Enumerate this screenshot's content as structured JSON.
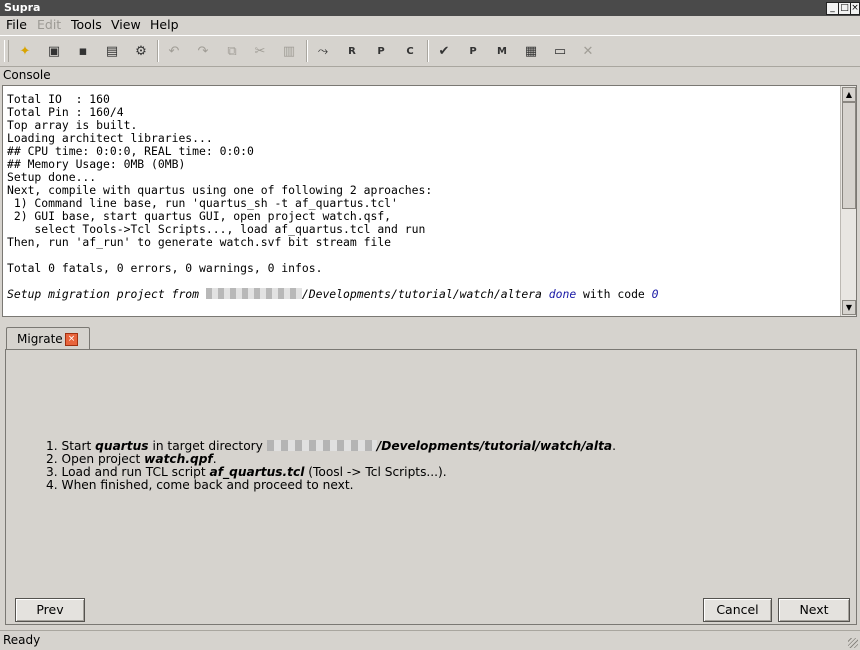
{
  "window": {
    "title": "Supra"
  },
  "menubar": {
    "items": [
      {
        "label": "File",
        "enabled": true
      },
      {
        "label": "Edit",
        "enabled": false
      },
      {
        "label": "Tools",
        "enabled": true
      },
      {
        "label": "View",
        "enabled": true
      },
      {
        "label": "Help",
        "enabled": true
      }
    ]
  },
  "toolbar": {
    "buttons": [
      {
        "icon": "new-project-icon",
        "glyph": "✦"
      },
      {
        "icon": "open-project-icon",
        "glyph": "▣"
      },
      {
        "icon": "save-icon",
        "glyph": "▪"
      },
      {
        "icon": "save-as-icon",
        "glyph": "▤"
      },
      {
        "icon": "settings-icon",
        "glyph": "⚙"
      },
      {
        "icon": "undo-icon",
        "glyph": "↶"
      },
      {
        "icon": "redo-icon",
        "glyph": "↷"
      },
      {
        "icon": "copy-icon",
        "glyph": "⧉"
      },
      {
        "icon": "cut-icon",
        "glyph": "✂"
      },
      {
        "icon": "paste-icon",
        "glyph": "▥"
      },
      {
        "icon": "migrate-icon",
        "glyph": "⤳"
      },
      {
        "icon": "run-r-icon",
        "glyph": "R"
      },
      {
        "icon": "run-p-icon",
        "glyph": "P"
      },
      {
        "icon": "run-c-icon",
        "glyph": "C"
      },
      {
        "icon": "check-icon",
        "glyph": "✔"
      },
      {
        "icon": "package-icon",
        "glyph": "P"
      },
      {
        "icon": "module-icon",
        "glyph": "M"
      },
      {
        "icon": "chip-icon",
        "glyph": "▦"
      },
      {
        "icon": "bitstream-icon",
        "glyph": "▭"
      },
      {
        "icon": "stop-icon",
        "glyph": "✕"
      }
    ]
  },
  "console": {
    "label": "Console",
    "lines": [
      "Total IO  : 160",
      "Total Pin : 160/4",
      "Top array is built.",
      "Loading architect libraries...",
      "## CPU time: 0:0:0, REAL time: 0:0:0",
      "## Memory Usage: 0MB (0MB)",
      "Setup done...",
      "Next, compile with quartus using one of following 2 aproaches:",
      " 1) Command line base, run 'quartus_sh -t af_quartus.tcl'",
      " 2) GUI base, start quartus GUI, open project watch.qsf,",
      "    select Tools->Tcl Scripts..., load af_quartus.tcl and run",
      "Then, run 'af_run' to generate watch.svf bit stream file",
      "",
      "Total 0 fatals, 0 errors, 0 warnings, 0 infos.",
      ""
    ],
    "final": {
      "prefix": "Setup migration project from ",
      "path": "/Developments/tutorial/watch/altera",
      "done": "done",
      "mid": " with code ",
      "code": "0"
    }
  },
  "tab": {
    "label": "Migrate",
    "close": "×"
  },
  "migrate": {
    "step1": {
      "pre": "Start ",
      "app": "quartus",
      "mid": " in target directory ",
      "path": "/Developments/tutorial/watch/alta",
      "end": "."
    },
    "step2": {
      "pre": "Open project ",
      "file": "watch.qpf",
      "end": "."
    },
    "step3": {
      "pre": "Load and run TCL script ",
      "file": "af_quartus.tcl",
      "end": " (Toosl -> Tcl Scripts...)."
    },
    "step4": {
      "text": "When finished, come back and proceed to next."
    },
    "buttons": {
      "prev": "Prev",
      "cancel": "Cancel",
      "next": "Next"
    }
  },
  "window_controls": {
    "minimize": "_",
    "maximize": "□",
    "close": "×"
  },
  "status": {
    "text": "Ready"
  }
}
